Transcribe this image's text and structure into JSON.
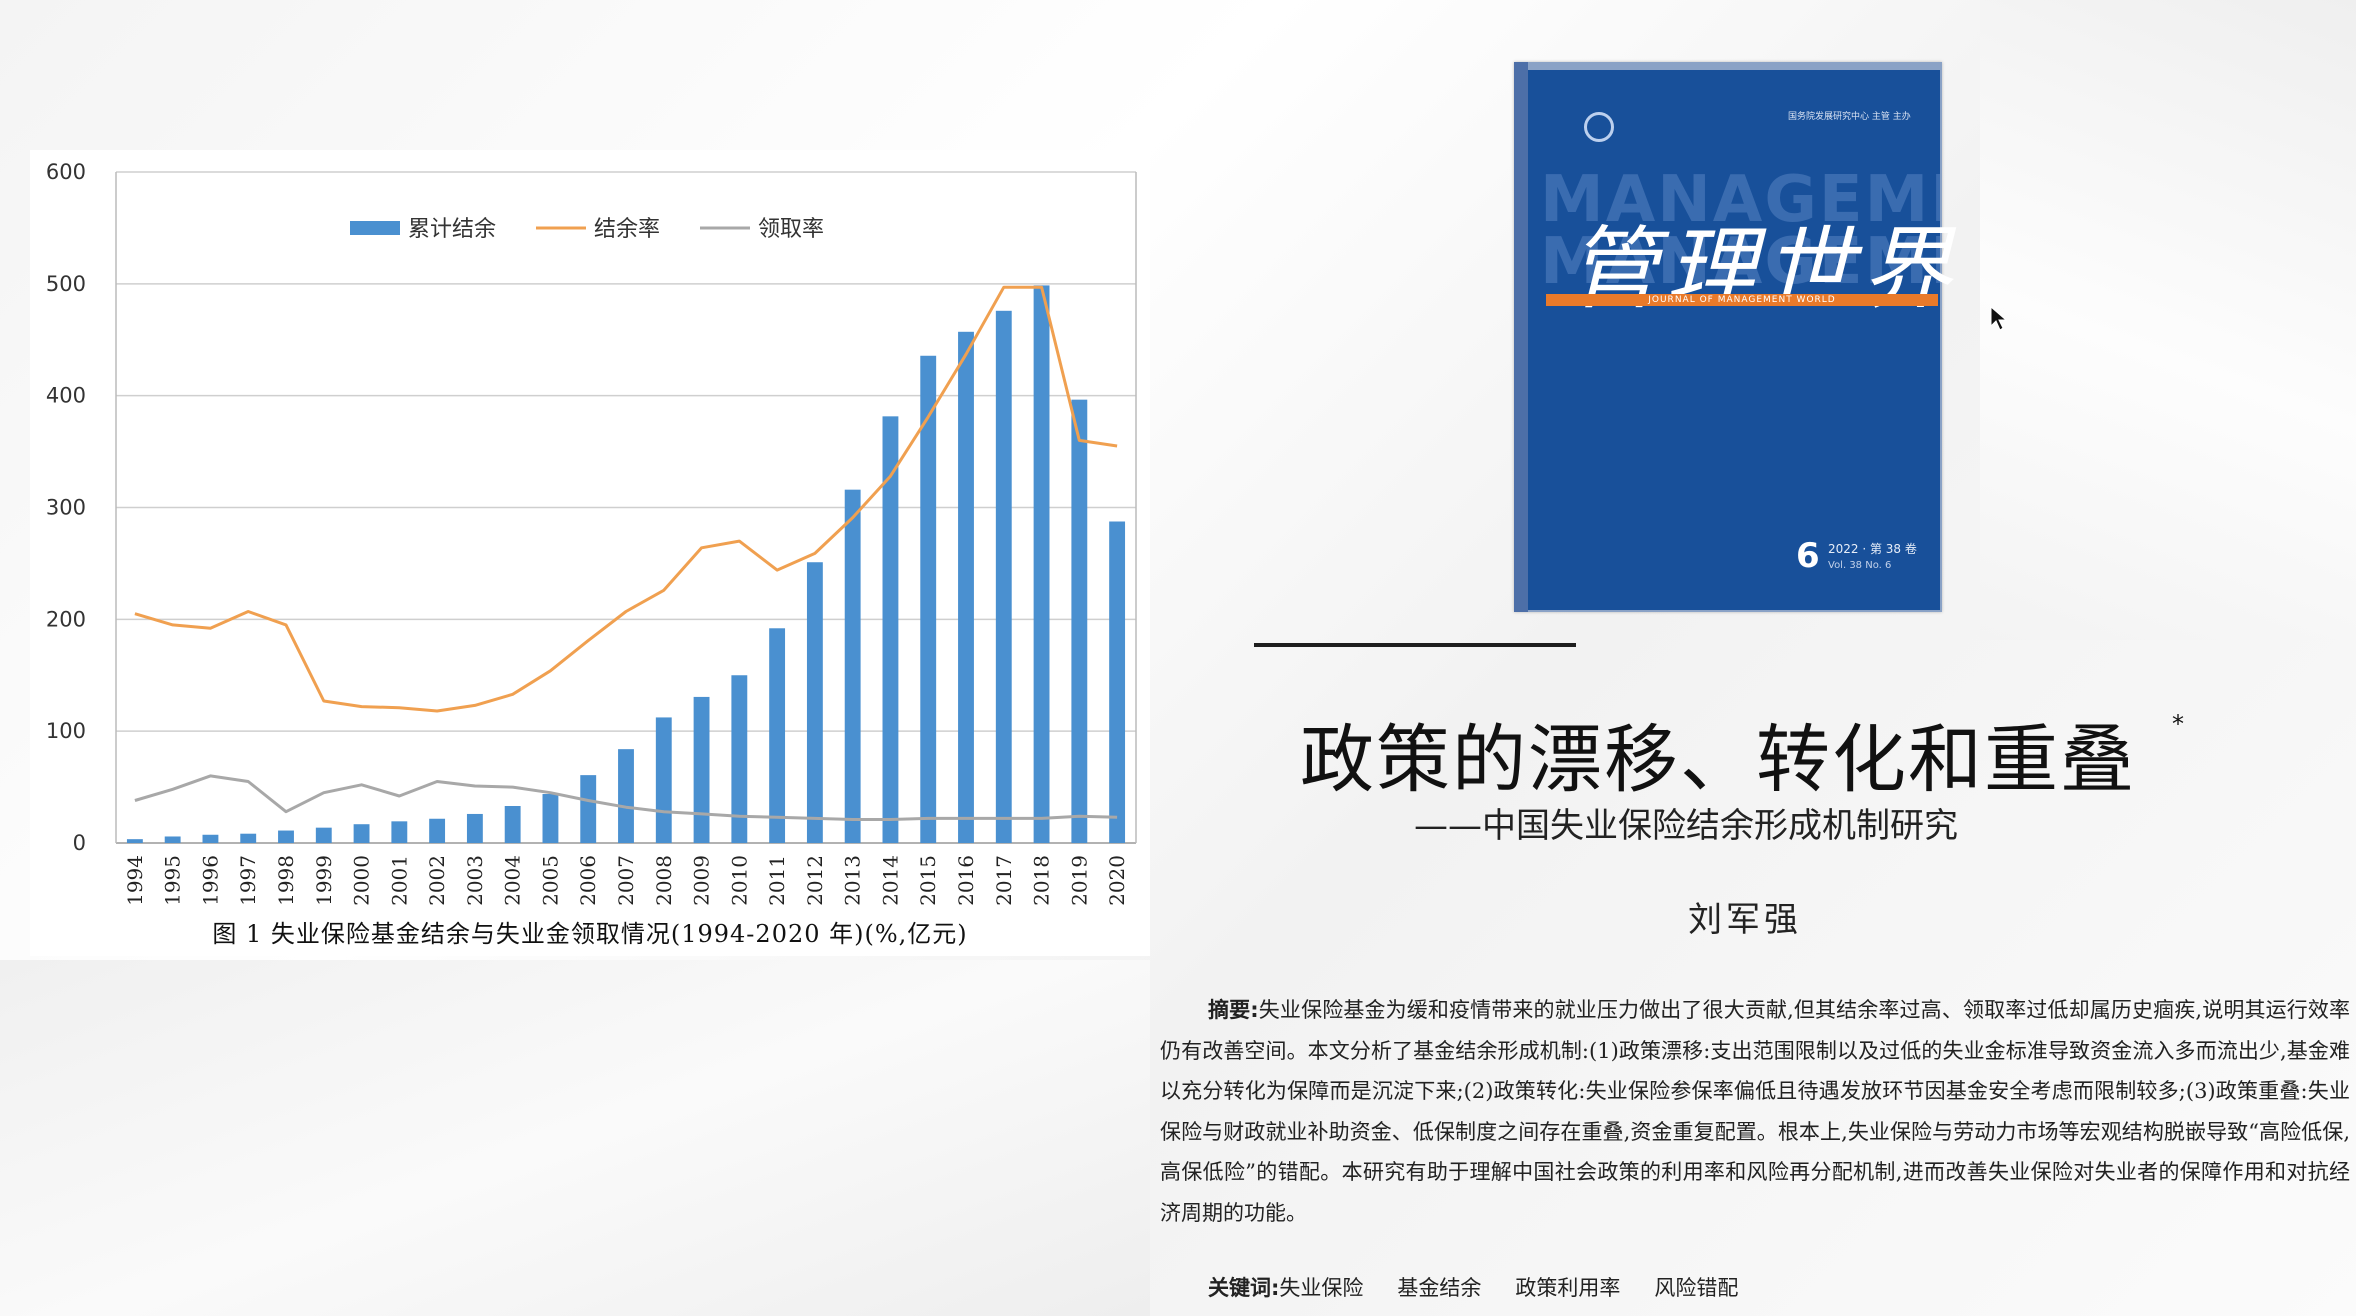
{
  "chart_data": {
    "type": "bar",
    "categories": [
      "1994",
      "1995",
      "1996",
      "1997",
      "1998",
      "1999",
      "2000",
      "2001",
      "2002",
      "2003",
      "2004",
      "2005",
      "2006",
      "2007",
      "2008",
      "2009",
      "2010",
      "2011",
      "2012",
      "2013",
      "2014",
      "2015",
      "2016",
      "2017",
      "2018",
      "2019",
      "2020"
    ],
    "series": [
      {
        "name": "累计结余",
        "type": "bar",
        "axis": "right",
        "color": "#4a90d0",
        "values": [
          40,
          68,
          86,
          97,
          130,
          160,
          196,
          226,
          253,
          303,
          386,
          511,
          708,
          979,
          1310,
          1524,
          1750,
          2240,
          2929,
          3686,
          4451,
          5083,
          5333,
          5552,
          5817,
          4625,
          3354
        ]
      },
      {
        "name": "结余率",
        "type": "line",
        "axis": "left",
        "color": "#f0a050",
        "values": [
          205,
          195,
          192,
          207,
          195,
          127,
          122,
          121,
          118,
          123,
          133,
          154,
          181,
          207,
          226,
          264,
          270,
          244,
          259,
          291,
          328,
          381,
          437,
          497,
          497,
          360,
          355
        ]
      },
      {
        "name": "领取率",
        "type": "line",
        "axis": "left",
        "color": "#a8a8a8",
        "values": [
          38,
          48,
          60,
          55,
          28,
          45,
          52,
          42,
          55,
          51,
          50,
          45,
          38,
          32,
          28,
          26,
          24,
          23,
          22,
          21,
          21,
          22,
          22,
          22,
          22,
          24,
          23
        ]
      }
    ],
    "ylim_left": [
      0,
      600
    ],
    "ylim_right": [
      0,
      7000
    ],
    "yticks_left": [
      "0",
      "100",
      "200",
      "300",
      "400",
      "500",
      "600"
    ],
    "yticks_right": [
      "0",
      "1000",
      "2000",
      "3000",
      "4000",
      "5000",
      "6000",
      "7000"
    ],
    "legend_position": "top-center",
    "grid": true,
    "caption": "图 1  失业保险基金结余与失业金领取情况(1994-2020 年)(%,亿元)"
  },
  "cover": {
    "title": "管理世界",
    "english": "JOURNAL OF MANAGEMENT WORLD",
    "ghost_text": "MANAGEMENT",
    "issue_number": "6",
    "issue_meta": "2022 · 第 38 卷",
    "issue_sub": "Vol. 38  No. 6",
    "publisher": "国务院发展研究中心  主管 主办",
    "background_color": "#18509a",
    "accent_color": "#e97a2a"
  },
  "paper": {
    "title": "政策的漂移、转化和重叠",
    "title_mark": "*",
    "subtitle": "——中国失业保险结余形成机制研究",
    "author": "刘军强",
    "abstract_label": "摘要:",
    "abstract_text": "失业保险基金为缓和疫情带来的就业压力做出了很大贡献,但其结余率过高、领取率过低却属历史痼疾,说明其运行效率仍有改善空间。本文分析了基金结余形成机制:(1)政策漂移:支出范围限制以及过低的失业金标准导致资金流入多而流出少,基金难以充分转化为保障而是沉淀下来;(2)政策转化:失业保险参保率偏低且待遇发放环节因基金安全考虑而限制较多;(3)政策重叠:失业保险与财政就业补助资金、低保制度之间存在重叠,资金重复配置。根本上,失业保险与劳动力市场等宏观结构脱嵌导致“高险低保,高保低险”的错配。本研究有助于理解中国社会政策的利用率和风险再分配机制,进而改善失业保险对失业者的保障作用和对抗经济周期的功能。",
    "keywords_label": "关键词:",
    "keywords": [
      "失业保险",
      "基金结余",
      "政策利用率",
      "风险错配"
    ]
  }
}
